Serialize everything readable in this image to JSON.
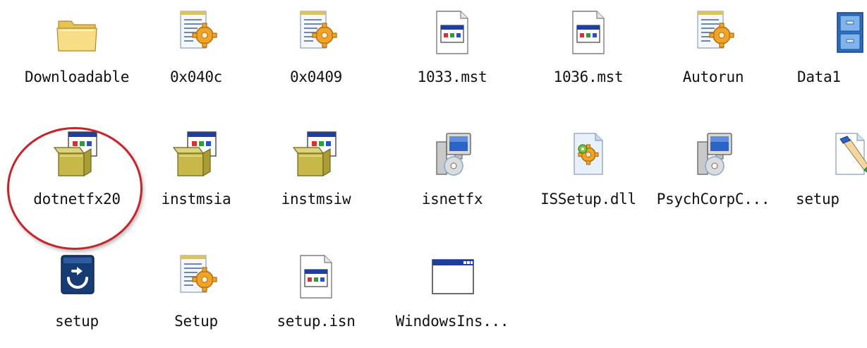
{
  "rows": [
    [
      {
        "label": "Downloadable",
        "icon": "folder-icon"
      },
      {
        "label": "0x040c",
        "icon": "config-settings-icon"
      },
      {
        "label": "0x0409",
        "icon": "config-settings-icon"
      },
      {
        "label": "1033.mst",
        "icon": "window-document-icon"
      },
      {
        "label": "1036.mst",
        "icon": "window-document-icon"
      },
      {
        "label": "Autorun",
        "icon": "config-settings-icon"
      },
      {
        "label": "Data1",
        "icon": "cabinet-icon"
      }
    ],
    [
      {
        "label": "dotnetfx20",
        "icon": "installer-package-icon"
      },
      {
        "label": "instmsia",
        "icon": "installer-package-icon"
      },
      {
        "label": "instmsiw",
        "icon": "installer-package-icon"
      },
      {
        "label": "isnetfx",
        "icon": "computer-cd-icon"
      },
      {
        "label": "ISSetup.dll",
        "icon": "dll-gear-icon"
      },
      {
        "label": "PsychCorpC...",
        "icon": "computer-cd-icon"
      },
      {
        "label": "setup",
        "icon": "paintbrush-file-icon"
      }
    ],
    [
      {
        "label": "setup",
        "icon": "blue-setup-icon"
      },
      {
        "label": "Setup",
        "icon": "config-settings-icon"
      },
      {
        "label": "setup.isn",
        "icon": "window-document-icon"
      },
      {
        "label": "WindowsIns...",
        "icon": "window-app-icon"
      }
    ]
  ],
  "highlight": {
    "target": "dotnetfx20",
    "color": "#c4262b"
  }
}
